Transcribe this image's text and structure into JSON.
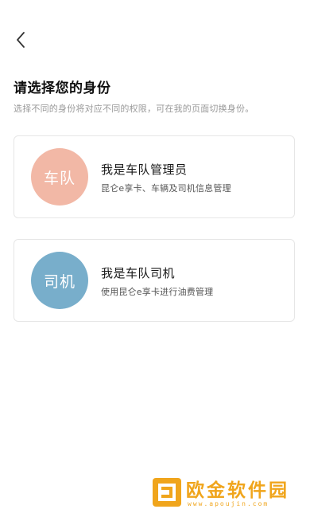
{
  "header": {
    "back_icon": "chevron-left-icon"
  },
  "page": {
    "title": "请选择您的身份",
    "subtitle": "选择不同的身份将对应不同的权限，可在我的页面切换身份。"
  },
  "roles": [
    {
      "avatar_label": "车队",
      "avatar_color": "#f2b8a6",
      "title": "我是车队管理员",
      "description": "昆仑e享卡、车辆及司机信息管理"
    },
    {
      "avatar_label": "司机",
      "avatar_color": "#78aecb",
      "title": "我是车队司机",
      "description": "使用昆仑e享卡进行油费管理"
    }
  ],
  "watermark": {
    "text": "欧金软件园",
    "url": "www.apoujin.com",
    "color": "#f0a51c"
  }
}
